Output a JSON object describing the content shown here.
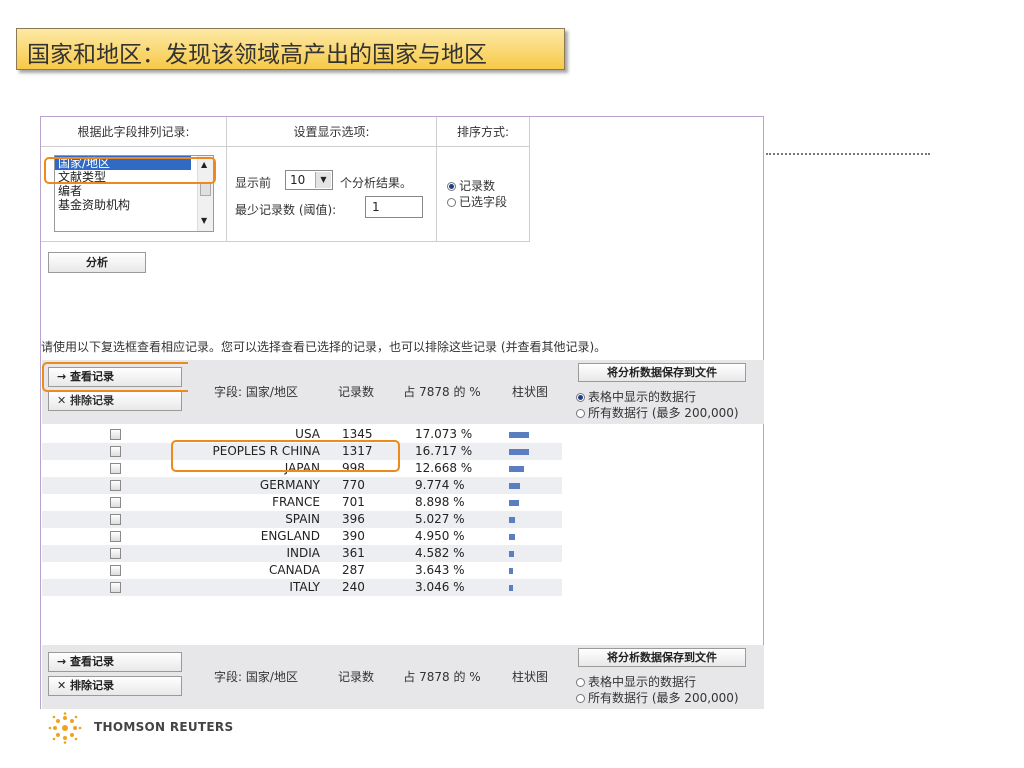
{
  "slide_title": "国家和地区：发现该领域高产出的国家与地区",
  "panel": {
    "sort_field_label": "根据此字段排列记录:",
    "display_options_label": "设置显示选项:",
    "sort_method_label": "排序方式:",
    "field_list": [
      "国家/地区",
      "文献类型",
      "编者",
      "基金资助机构"
    ],
    "field_selected": "国家/地区",
    "show_top_prefix": "显示前",
    "show_top_value": "10",
    "show_top_suffix": "个分析结果。",
    "min_records_label": "最少记录数 (阈值):",
    "min_records_value": "1",
    "sort_options": [
      "记录数",
      "已选字段"
    ],
    "sort_selected_index": 0,
    "analyze_button": "分析"
  },
  "instruction": "请使用以下复选框查看相应记录。您可以选择查看已选择的记录，也可以排除这些记录 (并查看其他记录)。",
  "table": {
    "view_records_button": "→ 查看记录",
    "exclude_records_button": "✕ 排除记录",
    "col_field": "字段: 国家/地区",
    "col_count": "记录数",
    "col_percent": "占 7878 的 %",
    "col_bar": "柱状图",
    "save_button": "将分析数据保存到文件",
    "save_options": [
      "表格中显示的数据行",
      "所有数据行 (最多 200,000)"
    ],
    "save_selected_index": 0,
    "rows": [
      {
        "name": "USA",
        "count": "1345",
        "percent": "17.073 %",
        "share": 17.073
      },
      {
        "name": "PEOPLES R CHINA",
        "count": "1317",
        "percent": "16.717 %",
        "share": 16.717
      },
      {
        "name": "JAPAN",
        "count": "998",
        "percent": "12.668 %",
        "share": 12.668
      },
      {
        "name": "GERMANY",
        "count": "770",
        "percent": "9.774 %",
        "share": 9.774
      },
      {
        "name": "FRANCE",
        "count": "701",
        "percent": "8.898 %",
        "share": 8.898
      },
      {
        "name": "SPAIN",
        "count": "396",
        "percent": "5.027 %",
        "share": 5.027
      },
      {
        "name": "ENGLAND",
        "count": "390",
        "percent": "4.950 %",
        "share": 4.95
      },
      {
        "name": "INDIA",
        "count": "361",
        "percent": "4.582 %",
        "share": 4.582
      },
      {
        "name": "CANADA",
        "count": "287",
        "percent": "3.643 %",
        "share": 3.643
      },
      {
        "name": "ITALY",
        "count": "240",
        "percent": "3.046 %",
        "share": 3.046
      }
    ]
  },
  "brand": "THOMSON REUTERS",
  "colors": {
    "highlight": "#ee8a1c",
    "bar": "#5b7ec0",
    "banner": "#f7c948"
  }
}
